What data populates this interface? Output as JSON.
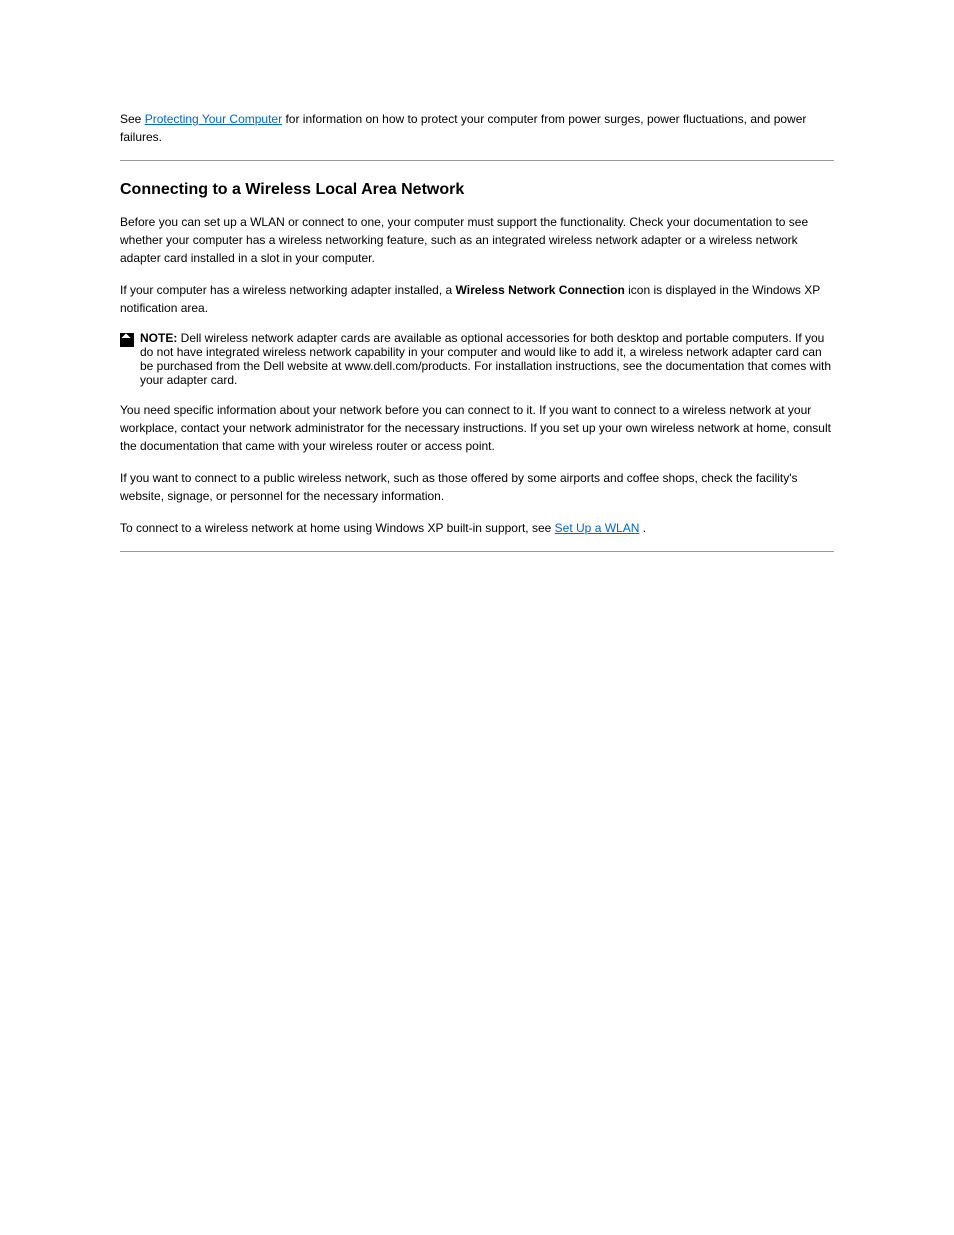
{
  "intro": {
    "see_text": "See ",
    "see_link": "Protecting Your Computer",
    "see_after": " for information on how to protect your computer from power surges, power fluctuations, and power failures."
  },
  "heading1": "Connecting to a Wireless Local Area Network",
  "para2": "Before you can set up a WLAN or connect to one, your computer must support the functionality. Check your documentation to see whether your computer has a wireless networking feature, such as an integrated wireless network adapter or a wireless network adapter card installed in a slot in your computer.",
  "para3_before": "If your computer has a wireless networking adapter installed, a ",
  "para3_bold": "Wireless Network Connection",
  "para3_after": " icon is displayed in the Windows XP notification area.",
  "note_bold": "NOTE: ",
  "note_text": "Dell wireless network adapter cards are available as optional accessories for both desktop and portable computers. If you do not have integrated wireless network capability in your computer and would like to add it, a wireless network adapter card can be purchased from the Dell website at www.dell.com/products. For installation instructions, see the documentation that comes with your adapter card.",
  "para5": "You need specific information about your network before you can connect to it. If you want to connect to a wireless network at your workplace, contact your network administrator for the necessary instructions. If you set up your own wireless network at home, consult the documentation that came with your wireless router or access point.",
  "para6": "If you want to connect to a public wireless network, such as those offered by some airports and coffee shops, check the facility's website, signage, or personnel for the necessary information.",
  "para7_before": "To connect to a wireless network at home using Windows XP built-in support, see ",
  "para7_link": "Set Up a WLAN",
  "para7_after": "."
}
